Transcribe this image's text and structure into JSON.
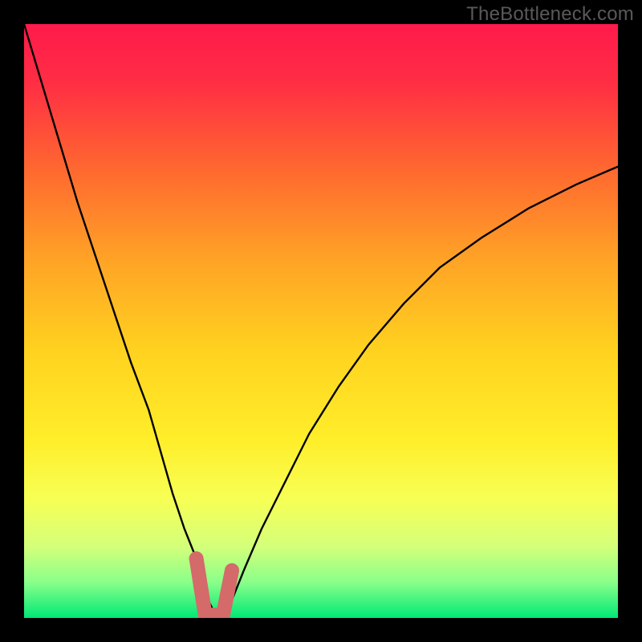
{
  "watermark": "TheBottleneck.com",
  "colors": {
    "frame": "#000000",
    "gradient_stops": [
      {
        "offset": 0.0,
        "color": "#ff1a4b"
      },
      {
        "offset": 0.1,
        "color": "#ff2e44"
      },
      {
        "offset": 0.25,
        "color": "#ff6a2f"
      },
      {
        "offset": 0.4,
        "color": "#ffa426"
      },
      {
        "offset": 0.55,
        "color": "#ffd21f"
      },
      {
        "offset": 0.7,
        "color": "#ffee2a"
      },
      {
        "offset": 0.8,
        "color": "#f7ff55"
      },
      {
        "offset": 0.88,
        "color": "#d4ff7a"
      },
      {
        "offset": 0.94,
        "color": "#8aff8a"
      },
      {
        "offset": 1.0,
        "color": "#00e876"
      }
    ],
    "curve": "#000000",
    "marker_fill": "#d46a6a",
    "marker_stroke": "#d46a6a"
  },
  "chart_data": {
    "type": "line",
    "title": "",
    "xlabel": "",
    "ylabel": "",
    "xlim": [
      0,
      100
    ],
    "ylim": [
      0,
      100
    ],
    "series": [
      {
        "name": "bottleneck-curve",
        "x": [
          0,
          3,
          6,
          9,
          12,
          15,
          18,
          21,
          23,
          25,
          27,
          29,
          30,
          31,
          32,
          33,
          34,
          35,
          37,
          40,
          44,
          48,
          53,
          58,
          64,
          70,
          77,
          85,
          93,
          100
        ],
        "values": [
          100,
          90,
          80,
          70,
          61,
          52,
          43,
          35,
          28,
          21,
          15,
          10,
          6,
          3,
          1,
          0,
          1,
          3,
          8,
          15,
          23,
          31,
          39,
          46,
          53,
          59,
          64,
          69,
          73,
          76
        ]
      }
    ],
    "annotations": [
      {
        "name": "min-marker",
        "x_range": [
          29,
          35
        ],
        "y_range": [
          0,
          10
        ]
      }
    ]
  }
}
